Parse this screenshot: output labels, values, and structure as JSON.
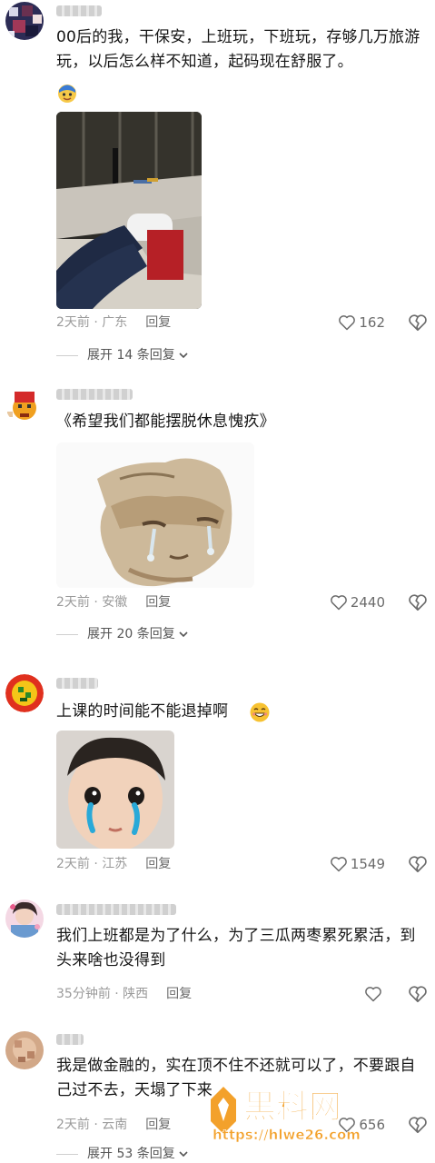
{
  "colors": {
    "meta_gray": "#9a9a9a",
    "text": "#161616",
    "watermark_orange": "#f29a1a"
  },
  "comments": [
    {
      "text": "00后的我，干保安，上班玩，下班玩，存够几万旅游玩，以后怎么样不知道，起码现在舒服了。",
      "time_location": "2天前 · 广东",
      "reply_label": "回复",
      "likes": "162",
      "expand_label": "展开 14 条回复",
      "has_inline_emoji": true,
      "image": "security-desk-photo"
    },
    {
      "text": "《希望我们都能摆脱休息愧疚》",
      "time_location": "2天前 · 安徽",
      "reply_label": "回复",
      "likes": "2440",
      "expand_label": "展开 20 条回复",
      "image": "crying-cat-meme"
    },
    {
      "text": "上课的时间能不能退掉啊",
      "time_location": "2天前 · 江苏",
      "reply_label": "回复",
      "likes": "1549",
      "image": "crying-child-meme"
    },
    {
      "text": "我们上班都是为了什么，为了三瓜两枣累死累活，到头来啥也没得到",
      "time_location": "35分钟前 · 陕西",
      "reply_label": "回复",
      "likes": ""
    },
    {
      "text": "我是做金融的，实在顶不住不还就可以了，不要跟自己过不去，天塌了下来",
      "time_location": "2天前 · 云南",
      "reply_label": "回复",
      "likes": "656",
      "expand_label": "展开 53 条回复"
    }
  ],
  "watermark": {
    "brand": "黑料网",
    "url": "https://hlwe26.com"
  }
}
